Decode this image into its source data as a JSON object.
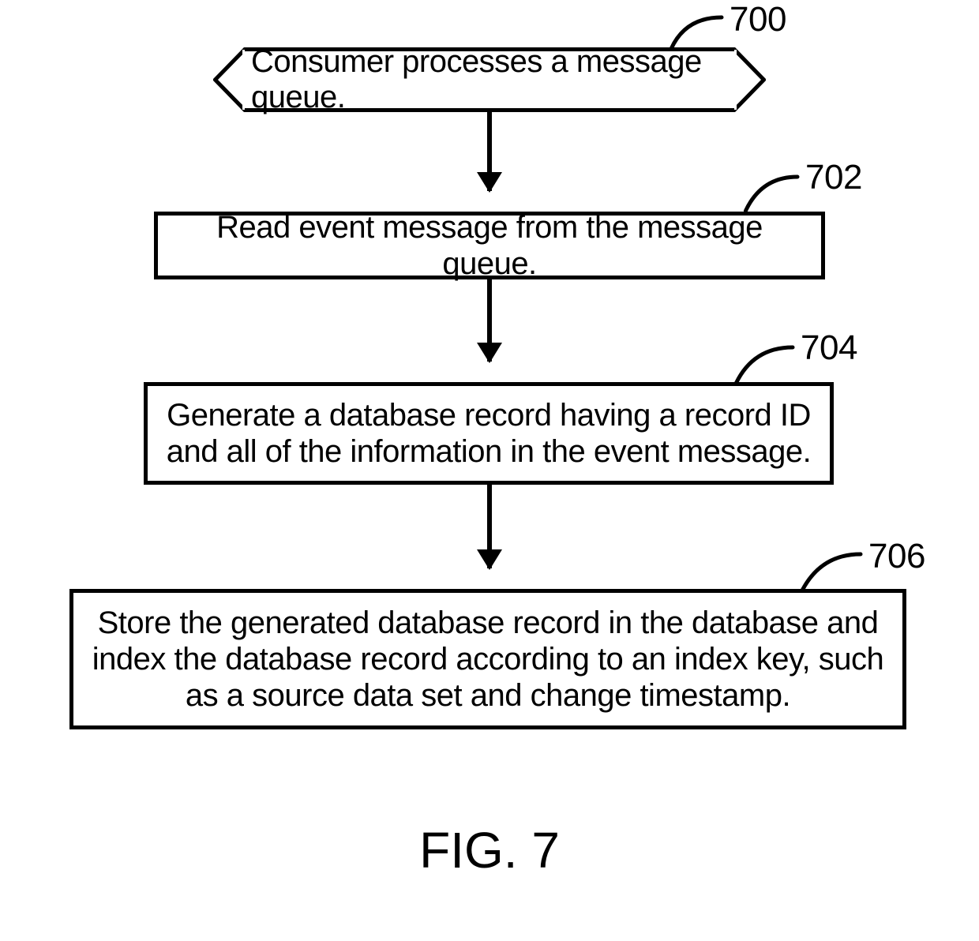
{
  "flow": {
    "terminator": {
      "label": "Consumer processes a message queue.",
      "ref": "700"
    },
    "step1": {
      "label": "Read event message from the message queue.",
      "ref": "702"
    },
    "step2": {
      "label": "Generate a database record having a record ID and all of the information in the event message.",
      "ref": "704"
    },
    "step3": {
      "label": "Store the generated database record in the database and index the database record according to an index key, such as a source data set and change timestamp.",
      "ref": "706"
    }
  },
  "caption": "FIG. 7"
}
